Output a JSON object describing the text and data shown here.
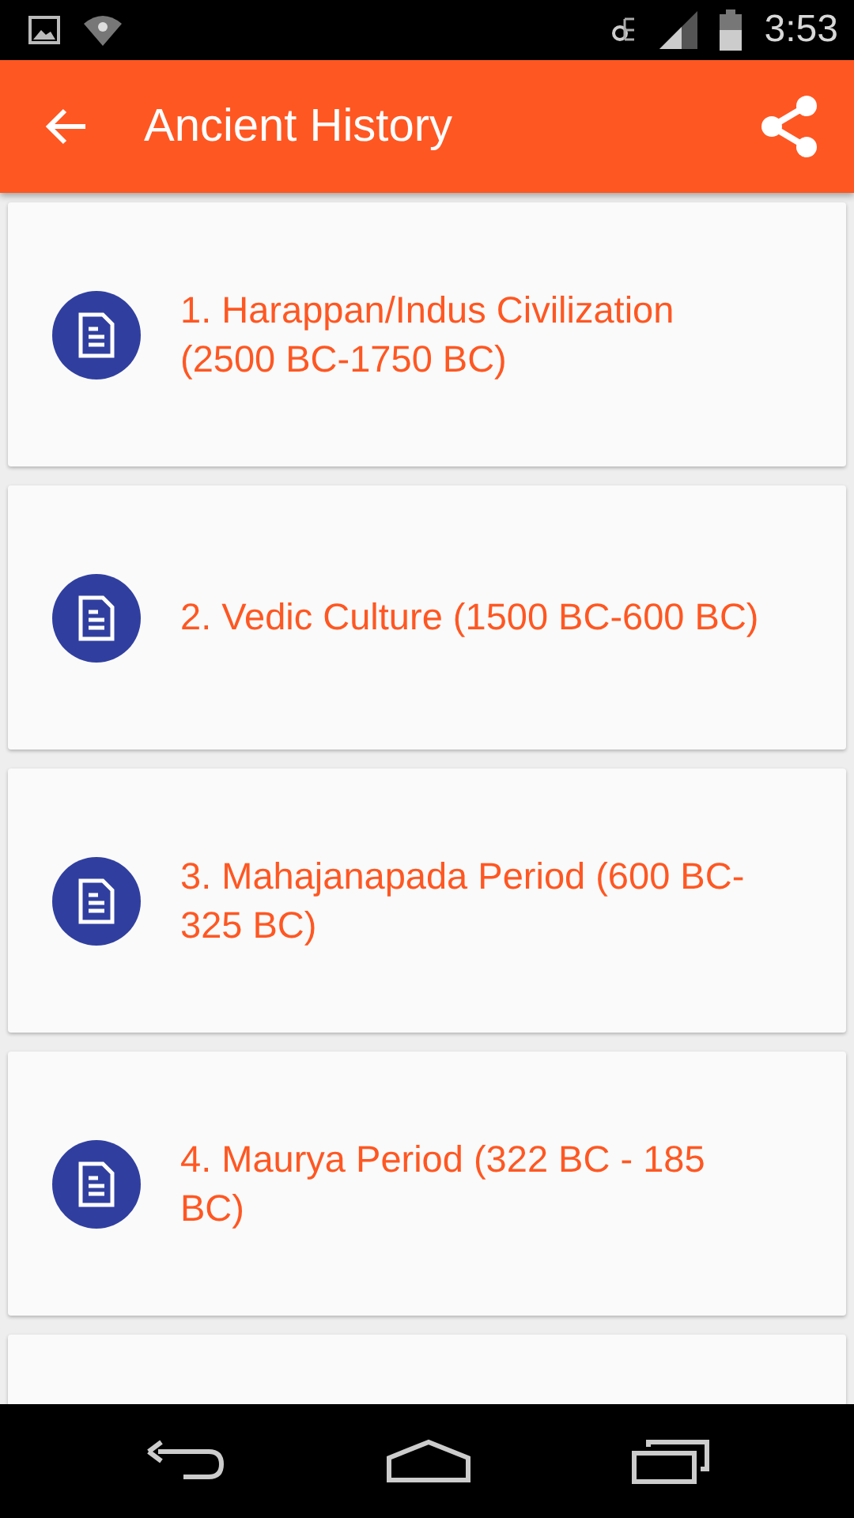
{
  "status_bar": {
    "time": "3:53"
  },
  "app_bar": {
    "title": "Ancient History"
  },
  "items": [
    {
      "title": "1. Harappan/Indus Civilization (2500 BC-1750 BC)"
    },
    {
      "title": "2. Vedic Culture (1500 BC-600 BC)"
    },
    {
      "title": "3. Mahajanapada Period (600 BC-325 BC)"
    },
    {
      "title": "4. Maurya Period (322 BC - 185 BC)"
    },
    {
      "kind": "partial"
    }
  ]
}
